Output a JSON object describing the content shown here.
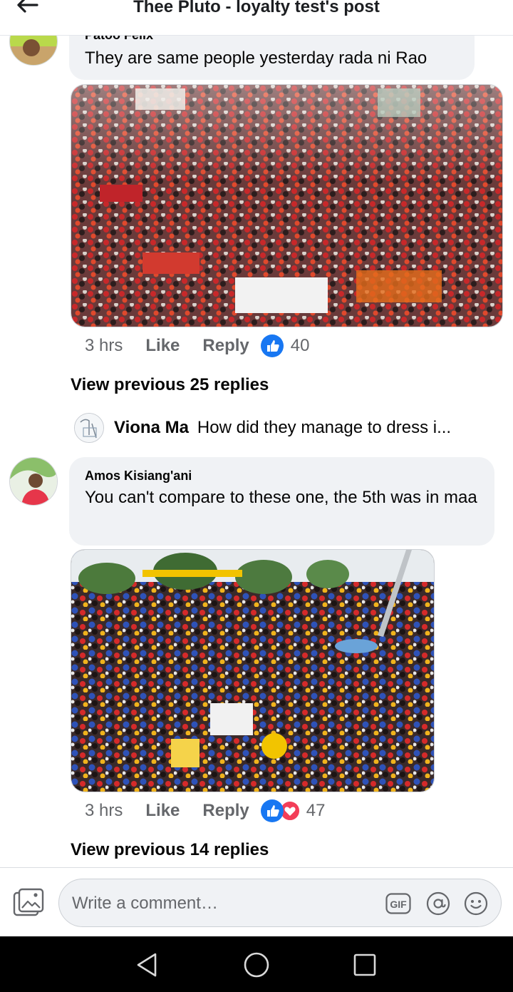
{
  "header": {
    "title": "Thee Pluto - loyalty test's post"
  },
  "comments": [
    {
      "author": "Patoo Felix",
      "text": "They are same people yesterday rada ni Rao",
      "time": "3 hrs",
      "like_label": "Like",
      "reply_label": "Reply",
      "reaction_count": "40",
      "reactions": [
        "like-icon"
      ],
      "view_previous": "View previous 25 replies"
    },
    {
      "author": "Amos Kisiang'ani",
      "text": "You can't compare to these one, the 5th was in maa",
      "time": "3 hrs",
      "like_label": "Like",
      "reply_label": "Reply",
      "reaction_count": "47",
      "reactions": [
        "like-icon",
        "love-icon"
      ],
      "view_previous": "View previous 14 replies"
    }
  ],
  "reply_preview": {
    "author": "Viona Ma",
    "text": "How did they manage to dress i..."
  },
  "composer": {
    "placeholder": "Write a comment…",
    "gif_label": "GIF"
  },
  "colors": {
    "accent": "#1877f2",
    "love": "#f33e58",
    "bubble": "#f0f2f5",
    "secondary_text": "#65676b"
  }
}
